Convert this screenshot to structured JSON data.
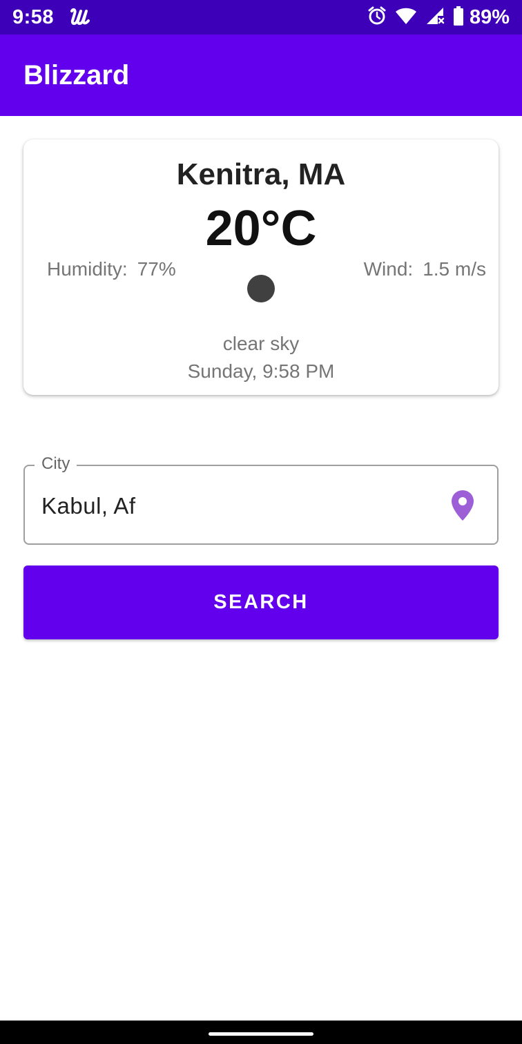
{
  "status_bar": {
    "time": "9:58",
    "battery_percent": "89%",
    "icons": [
      "u-app-icon",
      "alarm-icon",
      "wifi-icon",
      "signal-icon",
      "battery-icon"
    ]
  },
  "app_bar": {
    "title": "Blizzard"
  },
  "weather_card": {
    "city": "Kenitra, MA",
    "temperature": "20°C",
    "humidity_label": "Humidity:",
    "humidity_value": "77%",
    "wind_label": "Wind:",
    "wind_value": "1.5 m/s",
    "description": "clear sky",
    "datetime": "Sunday, 9:58 PM",
    "icon": "weather-condition-icon"
  },
  "city_field": {
    "label": "City",
    "value": "Kabul, Af",
    "icon": "location-pin-icon"
  },
  "search_button": {
    "label": "SEARCH"
  },
  "colors": {
    "status_bar": "#3d00b8",
    "primary": "#6200ee",
    "location_icon": "#9c5fd6",
    "secondary_text": "#757575"
  }
}
